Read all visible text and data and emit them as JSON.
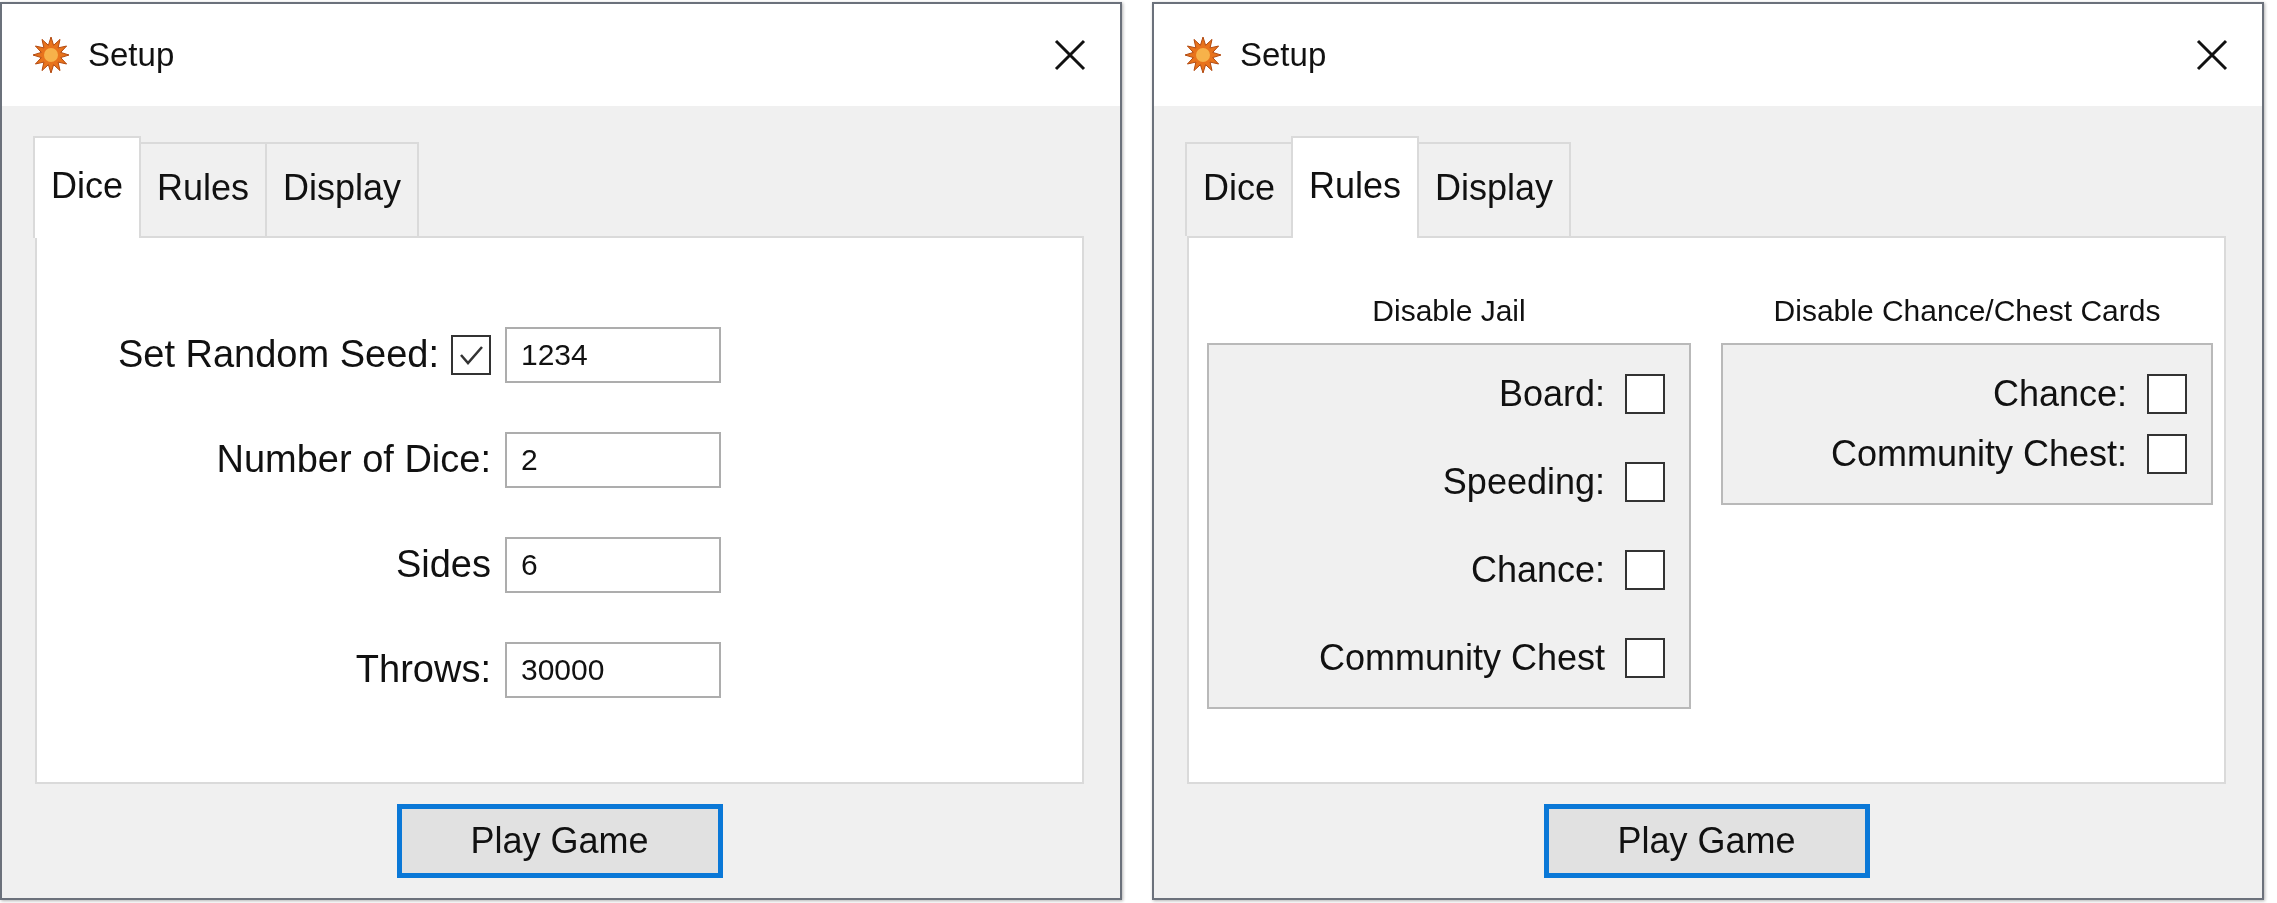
{
  "windows": [
    {
      "title": "Setup",
      "tabs": [
        {
          "label": "Dice",
          "selected": true
        },
        {
          "label": "Rules",
          "selected": false
        },
        {
          "label": "Display",
          "selected": false
        }
      ],
      "panel": {
        "kind": "dice",
        "fields": [
          {
            "label": "Set Random Seed:",
            "checked": true,
            "value": "1234"
          },
          {
            "label": "Number of Dice:",
            "value": "2"
          },
          {
            "label": "Sides",
            "value": "6"
          },
          {
            "label": "Throws:",
            "value": "30000"
          }
        ]
      },
      "button": {
        "label": "Play Game",
        "focused": true
      }
    },
    {
      "title": "Setup",
      "tabs": [
        {
          "label": "Dice",
          "selected": false
        },
        {
          "label": "Rules",
          "selected": true
        },
        {
          "label": "Display",
          "selected": false
        }
      ],
      "panel": {
        "kind": "rules",
        "groups": [
          {
            "heading": "Disable Jail",
            "items": [
              {
                "label": "Board:",
                "checked": false
              },
              {
                "label": "Speeding:",
                "checked": false
              },
              {
                "label": "Chance:",
                "checked": false
              },
              {
                "label": "Community Chest",
                "checked": false
              }
            ]
          },
          {
            "heading": "Disable Chance/Chest Cards",
            "items": [
              {
                "label": "Chance:",
                "checked": false
              },
              {
                "label": "Community Chest:",
                "checked": false
              }
            ]
          }
        ]
      },
      "button": {
        "label": "Play Game",
        "focused": true
      }
    }
  ]
}
